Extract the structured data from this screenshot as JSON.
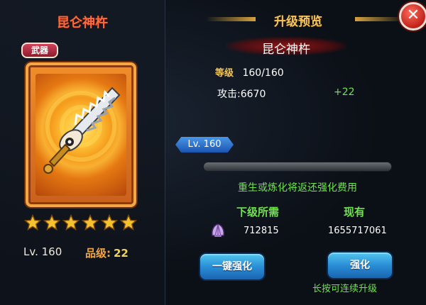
{
  "item": {
    "name": "昆仑神杵",
    "type_tag": "武器",
    "stars": 6,
    "level": "Lv. 160",
    "grade_label": "品级:",
    "grade_value": "22"
  },
  "panel": {
    "header_title": "升级预览",
    "item_name": "昆仑神杵",
    "level_label": "等级",
    "level_value": "160/160",
    "attack_label": "攻击:6670",
    "attack_increase": "+22",
    "lv_badge": "Lv. 160",
    "progress_fraction": 1.0,
    "notice": "重生或炼化将返还强化费用",
    "col_required": "下级所需",
    "col_owned": "现有",
    "required_value": "712815",
    "owned_value": "1655717061",
    "resource_icon": "shell-icon"
  },
  "buttons": {
    "one_key": "一键强化",
    "enhance": "强化",
    "hint": "长按可连续升级",
    "close": "✕"
  },
  "colors": {
    "accent_gold": "#f5c45b",
    "green": "#6ee44a",
    "item_name_orange": "#ff6a3d",
    "button_blue": "#2a8ed6"
  }
}
